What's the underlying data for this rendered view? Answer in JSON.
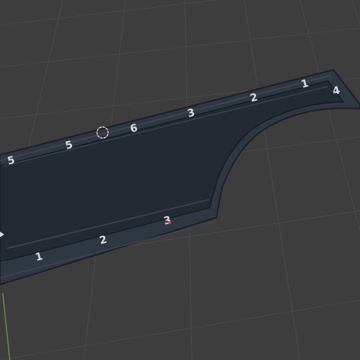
{
  "viewport": {
    "background_color": "#3d3d3d",
    "grid_color": "#4c4c4c",
    "axis_y_color": "#6b9b2e"
  },
  "model": {
    "plate_color": "#232a33",
    "rim_color": "#2f3742",
    "edge_color": "#1a1f26",
    "top_row_labels": [
      "1",
      "2",
      "3",
      "4",
      "5",
      "6",
      "5"
    ],
    "bottom_row_labels": [
      "1",
      "2",
      "3"
    ]
  },
  "cursor": {
    "icon": "3d-cursor-icon",
    "color": "#e8505b"
  }
}
